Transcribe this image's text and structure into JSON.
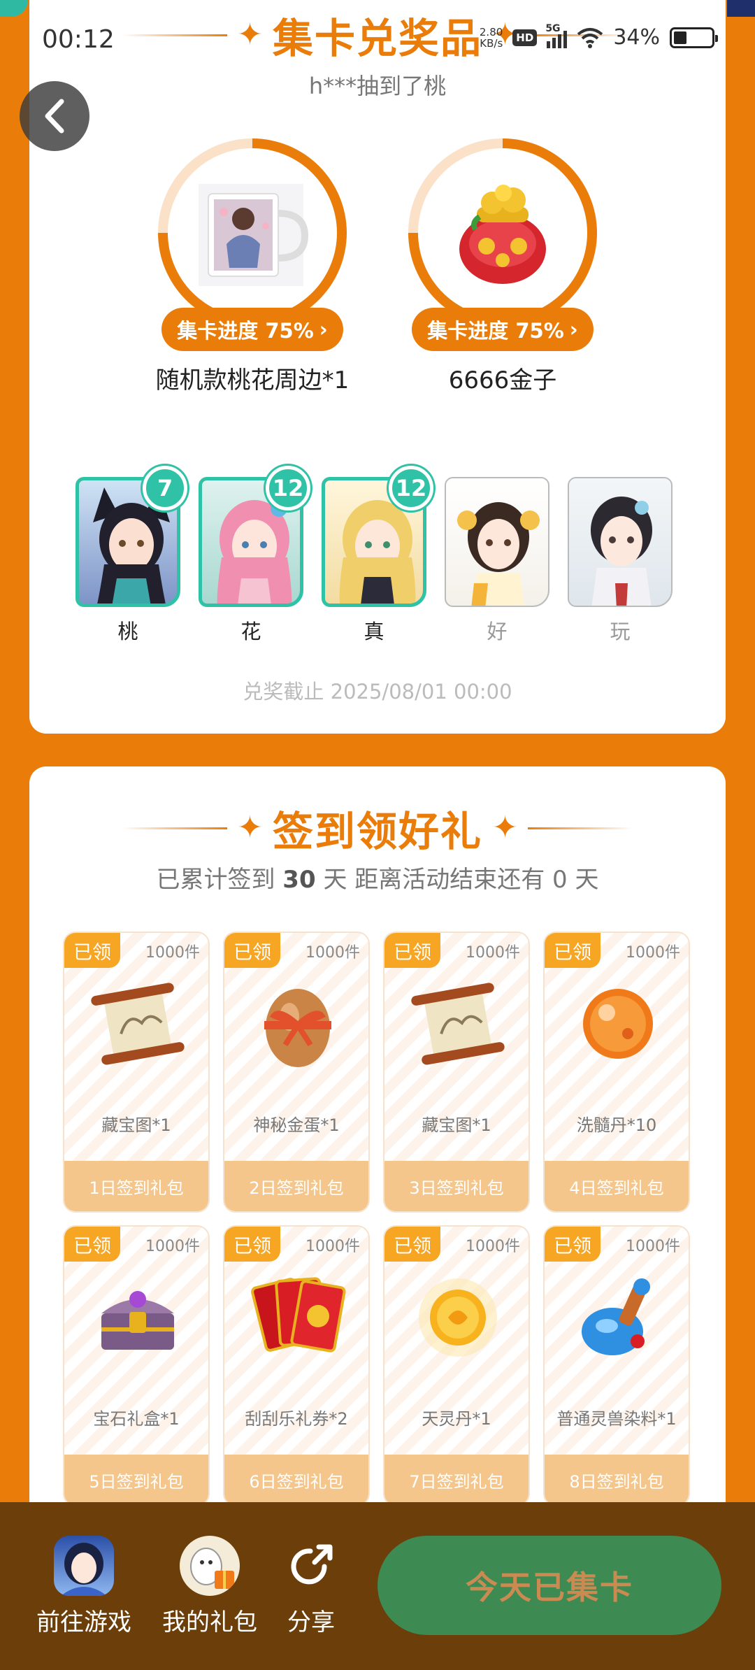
{
  "status_bar": {
    "time": "00:12",
    "net_speed": "2.80",
    "net_unit": "KB/s",
    "hd": "HD",
    "network": "5G",
    "battery": "34%"
  },
  "collect": {
    "title": "集卡兑奖品",
    "ticker": "h***抽到了桃",
    "prizes": [
      {
        "progress_label": "集卡进度 75%",
        "progress": 0.75,
        "name": "随机款桃花周边*1",
        "icon": "mug-image"
      },
      {
        "progress_label": "集卡进度 75%",
        "progress": 0.75,
        "name": "6666金子",
        "icon": "gold-pot-image"
      }
    ],
    "cards": [
      {
        "name": "桃",
        "count": "7",
        "owned": true
      },
      {
        "name": "花",
        "count": "12",
        "owned": true
      },
      {
        "name": "真",
        "count": "12",
        "owned": true
      },
      {
        "name": "好",
        "owned": false
      },
      {
        "name": "玩",
        "owned": false
      }
    ],
    "deadline": "兑奖截止 2025/08/01 00:00"
  },
  "signin": {
    "title": "签到领好礼",
    "prefix": "已累计签到",
    "days": "30",
    "unit": "天",
    "remaining": "距离活动结束还有 0 天",
    "gifts": [
      {
        "tag": "已领",
        "qty": "1000件",
        "name": "藏宝图*1",
        "day": "1日签到礼包",
        "icon": "scroll-map-icon"
      },
      {
        "tag": "已领",
        "qty": "1000件",
        "name": "神秘金蛋*1",
        "day": "2日签到礼包",
        "icon": "golden-egg-icon"
      },
      {
        "tag": "已领",
        "qty": "1000件",
        "name": "藏宝图*1",
        "day": "3日签到礼包",
        "icon": "scroll-map-icon"
      },
      {
        "tag": "已领",
        "qty": "1000件",
        "name": "洗髓丹*10",
        "day": "4日签到礼包",
        "icon": "orange-pill-icon"
      },
      {
        "tag": "已领",
        "qty": "1000件",
        "name": "宝石礼盒*1",
        "day": "5日签到礼包",
        "icon": "gem-chest-icon"
      },
      {
        "tag": "已领",
        "qty": "1000件",
        "name": "刮刮乐礼券*2",
        "day": "6日签到礼包",
        "icon": "scratch-card-icon"
      },
      {
        "tag": "已领",
        "qty": "1000件",
        "name": "天灵丹*1",
        "day": "7日签到礼包",
        "icon": "glowing-orb-icon"
      },
      {
        "tag": "已领",
        "qty": "1000件",
        "name": "普通灵兽染料*1",
        "day": "8日签到礼包",
        "icon": "potion-bottle-icon"
      }
    ]
  },
  "bottom": {
    "go_game": "前往游戏",
    "my_gifts": "我的礼包",
    "share": "分享",
    "cta": "今天已集卡"
  },
  "colors": {
    "accent": "#ea7d0a",
    "teal": "#2fc2a6",
    "cta_bg": "#3d8a52",
    "bar_bg": "#6b3e0a"
  }
}
